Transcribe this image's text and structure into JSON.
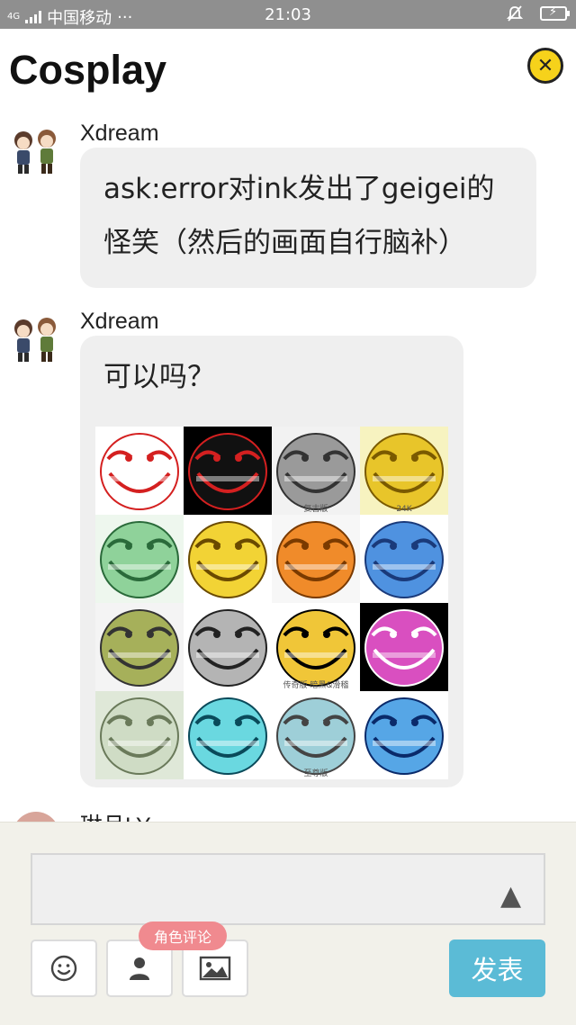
{
  "status_bar": {
    "network": "4G",
    "carrier": "中国移动",
    "more": "···",
    "time": "21:03"
  },
  "header": {
    "title": "Cosplay"
  },
  "messages": [
    {
      "username": "Xdream",
      "text_lines": [
        "ask:error对ink发出了geigei的",
        "怪笑（然后的画面自行脑补）"
      ]
    },
    {
      "username": "Xdream",
      "text": "可以吗？",
      "image_captions": [
        "",
        "",
        "复古版",
        "24K",
        "",
        "",
        "",
        "",
        "",
        "",
        "传奇版 暗黑&滑稽",
        "",
        "",
        "",
        "至尊版",
        ""
      ]
    },
    {
      "username": "琳且LY"
    }
  ],
  "composer": {
    "role_comment_label": "角色评论",
    "publish_label": "发表"
  },
  "colors": {
    "status_bar": "#8f8f8f",
    "bubble": "#efefef",
    "close_button": "#f6d21b",
    "role_tag": "#f08a8f",
    "publish_button": "#5bbbd6",
    "panel": "#f2f1ea"
  },
  "icons": [
    "close-icon",
    "emoji-icon",
    "person-icon",
    "image-icon",
    "send-arrow-icon",
    "battery-icon",
    "mute-icon"
  ]
}
